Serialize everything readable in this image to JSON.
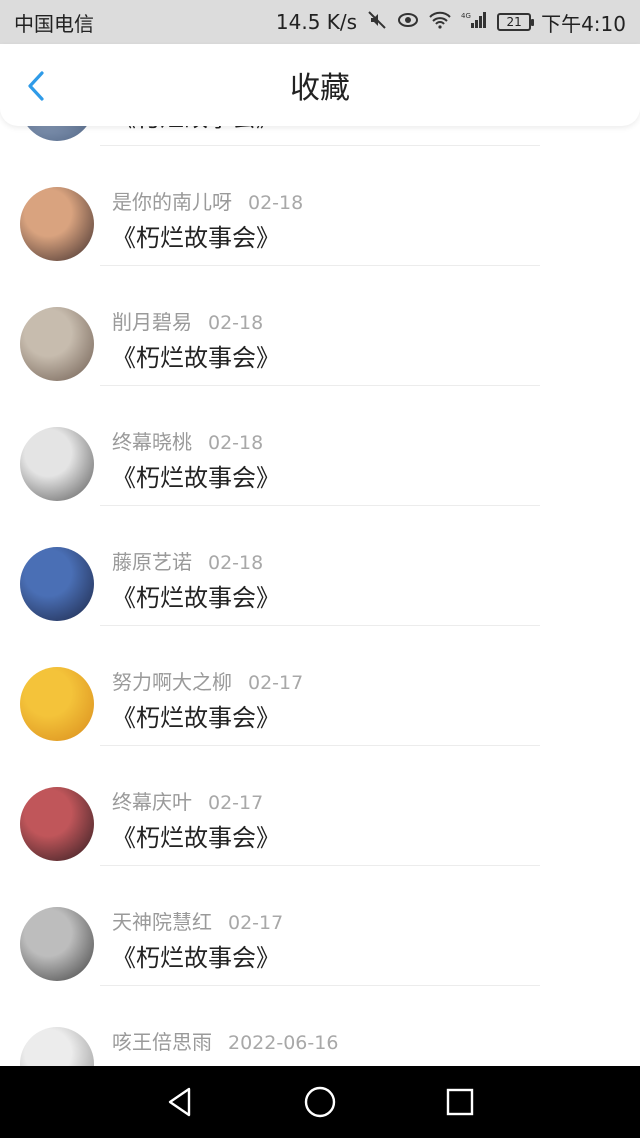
{
  "status_bar": {
    "carrier": "中国电信",
    "speed": "14.5 K/s",
    "network_label": "4G",
    "battery": "21",
    "time": "下午4:10"
  },
  "header": {
    "title": "收藏",
    "back_icon": "chevron-left-icon",
    "accent_color": "#2f9be8"
  },
  "items": [
    {
      "user": "",
      "date": "",
      "title": "《朽烂故事会》",
      "avatar_colors": [
        "#8da0bd",
        "#4b5f7e"
      ]
    },
    {
      "user": "是你的南儿呀",
      "date": "02-18",
      "title": "《朽烂故事会》",
      "avatar_colors": [
        "#d9a37f",
        "#3a2a2a"
      ]
    },
    {
      "user": "削月碧易",
      "date": "02-18",
      "title": "《朽烂故事会》",
      "avatar_colors": [
        "#c7bcae",
        "#6c5a4e"
      ]
    },
    {
      "user": "终幕晓桃",
      "date": "02-18",
      "title": "《朽烂故事会》",
      "avatar_colors": [
        "#e4e4e4",
        "#555555"
      ]
    },
    {
      "user": "藤原艺诺",
      "date": "02-18",
      "title": "《朽烂故事会》",
      "avatar_colors": [
        "#4a6fb5",
        "#1c2544"
      ]
    },
    {
      "user": "努力啊大之柳",
      "date": "02-17",
      "title": "《朽烂故事会》",
      "avatar_colors": [
        "#f4c33a",
        "#d88a1c"
      ]
    },
    {
      "user": "终幕庆叶",
      "date": "02-17",
      "title": "《朽烂故事会》",
      "avatar_colors": [
        "#c0565a",
        "#2b1b1f"
      ]
    },
    {
      "user": "天神院慧红",
      "date": "02-17",
      "title": "《朽烂故事会》",
      "avatar_colors": [
        "#bdbdbd",
        "#3d3d3d"
      ]
    },
    {
      "user": "咳王倍思雨",
      "date": "2022-06-16",
      "title": "",
      "avatar_colors": [
        "#ececec",
        "#8a8a8a"
      ]
    }
  ],
  "system_nav": {
    "back_icon": "triangle-back-icon",
    "home_icon": "circle-home-icon",
    "recents_icon": "square-recents-icon"
  }
}
